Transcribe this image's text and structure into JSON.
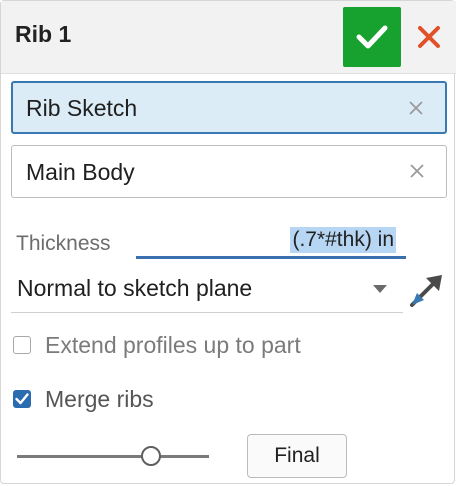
{
  "dialog": {
    "title": "Rib 1",
    "ok_icon": "checkmark-icon",
    "close_icon": "close-x-icon",
    "colors": {
      "ok": "#17a12e",
      "close": "#e0512a",
      "accent": "#3a78b2",
      "selection": "#dcecf7"
    }
  },
  "selections": [
    {
      "label": "Rib Sketch",
      "active": true,
      "clear_icon": "clear-x-icon"
    },
    {
      "label": "Main Body",
      "active": false,
      "clear_icon": "clear-x-icon"
    }
  ],
  "thickness": {
    "label": "Thickness",
    "value": "(.7*#thk) in"
  },
  "direction": {
    "value": "Normal to sketch plane",
    "flip_icon": "flip-direction-arrow-icon"
  },
  "options": {
    "extend_profiles": {
      "label": "Extend profiles up to part",
      "checked": false
    },
    "merge_ribs": {
      "label": "Merge ribs",
      "checked": true
    }
  },
  "rollback": {
    "slider_position": 0.7,
    "final_label": "Final"
  }
}
